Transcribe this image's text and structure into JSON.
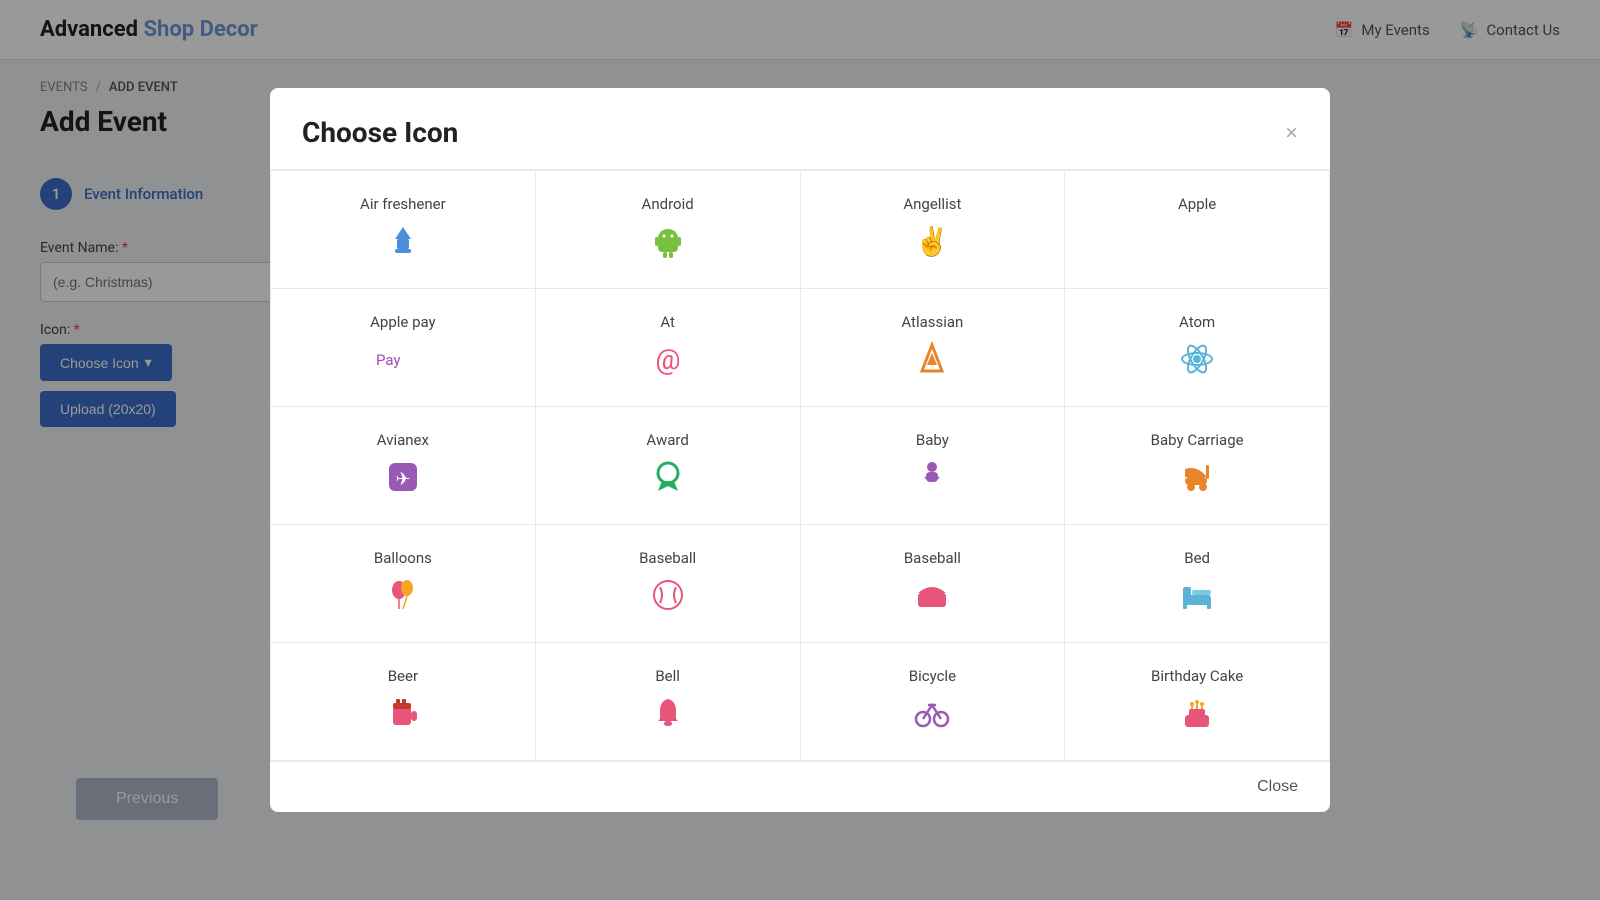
{
  "site": {
    "brand_bold": "Advanced",
    "brand_light": " Shop Decor"
  },
  "nav": {
    "my_events_label": "My Events",
    "contact_us_label": "Contact Us"
  },
  "breadcrumb": {
    "events": "EVENTS",
    "separator": "/",
    "add_event": "ADD EVENT"
  },
  "page": {
    "title": "Add Event"
  },
  "form": {
    "step_number": "1",
    "step_label": "Event Information",
    "event_name_label": "Event Name:",
    "event_name_placeholder": "(e.g. Christmas)",
    "icon_label": "Icon:",
    "choose_icon_btn": "Choose Icon",
    "upload_btn": "Upload (20x20)",
    "previous_btn": "Previous"
  },
  "modal": {
    "title": "Choose Icon",
    "close_x": "×",
    "close_btn": "Close",
    "icons": [
      {
        "name": "Air freshener",
        "glyph": "⛩",
        "color": "#4a90d9"
      },
      {
        "name": "Android",
        "glyph": "🤖",
        "color": "#78c040"
      },
      {
        "name": "Angellist",
        "glyph": "✌️",
        "color": "#e8852a"
      },
      {
        "name": "Apple",
        "glyph": "",
        "color": "#222222"
      },
      {
        "name": "Apple pay",
        "glyph": " Pay",
        "color": "#aa44bb",
        "is_text": true
      },
      {
        "name": "At",
        "glyph": "@",
        "color": "#e8557a"
      },
      {
        "name": "Atlassian",
        "glyph": "▲",
        "color": "#e8852a"
      },
      {
        "name": "Atom",
        "glyph": "⚛",
        "color": "#5ab4d6"
      },
      {
        "name": "Avianex",
        "glyph": "✈",
        "color": "#9b59b6",
        "bg": "#9b59b6"
      },
      {
        "name": "Award",
        "glyph": "🏅",
        "color": "#27ae60"
      },
      {
        "name": "Baby",
        "glyph": "👶",
        "color": "#9b59b6"
      },
      {
        "name": "Baby Carriage",
        "glyph": "🛒",
        "color": "#e8852a"
      },
      {
        "name": "Balloons",
        "glyph": "🎈",
        "color": "#e8557a"
      },
      {
        "name": "Baseball",
        "glyph": "⚾",
        "color": "#e8557a"
      },
      {
        "name": "Baseball",
        "glyph": "🏟",
        "color": "#e8557a"
      },
      {
        "name": "Bed",
        "glyph": "🛏",
        "color": "#5ab4d6"
      },
      {
        "name": "Beer",
        "glyph": "🍺",
        "color": "#e8557a"
      },
      {
        "name": "Bell",
        "glyph": "🔔",
        "color": "#e8557a"
      },
      {
        "name": "Bicycle",
        "glyph": "🚲",
        "color": "#9b59b6"
      },
      {
        "name": "Birthday Cake",
        "glyph": "🎂",
        "color": "#e8557a"
      }
    ]
  }
}
